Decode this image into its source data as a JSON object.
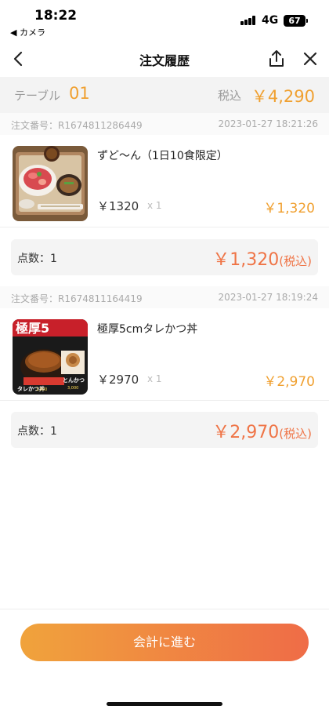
{
  "status_bar": {
    "time": "18:22",
    "back_app": "◀ カメラ",
    "network": "4G",
    "battery": "67"
  },
  "nav": {
    "title": "注文履歴",
    "back_icon": "chevron-left-icon",
    "share_icon": "share-icon",
    "close_icon": "close-icon"
  },
  "summary": {
    "table_label": "テーブル",
    "table_number": "01",
    "tax_label": "税込",
    "total": "￥4,290"
  },
  "orders": [
    {
      "order_id": "注文番号：R1674811286449",
      "time": "2023-01-27 18:21:26",
      "item": {
        "name": "ずど〜ん（1日10食限定）",
        "price": "￥1320",
        "qty": "x 1",
        "subtotal": "￥1,320",
        "thumb_icon": "sashimi-bowl-set-image"
      },
      "count_label": "点数：1",
      "count_total": "￥1,320",
      "count_tax": "(税込)"
    },
    {
      "order_id": "注文番号：R1674811164419",
      "time": "2023-01-27 18:19:24",
      "item": {
        "name": "極厚5cmタレかつ丼",
        "price": "￥2970",
        "qty": "x 1",
        "subtotal": "￥2,970",
        "thumb_icon": "katsudon-poster-image",
        "thumb_text": {
          "headline": "極厚5",
          "left_caption": "タレかつ丼",
          "left_price": "3,000",
          "right_caption": "とんかつ",
          "right_price": "3,000"
        }
      },
      "count_label": "点数：1",
      "count_total": "￥2,970",
      "count_tax": "(税込)"
    }
  ],
  "footer": {
    "checkout_label": "会計に進む"
  },
  "colors": {
    "accent": "#f0a030",
    "total_accent": "#ef7446",
    "button_gradient_start": "#f0a33c",
    "button_gradient_end": "#ef6c47"
  }
}
